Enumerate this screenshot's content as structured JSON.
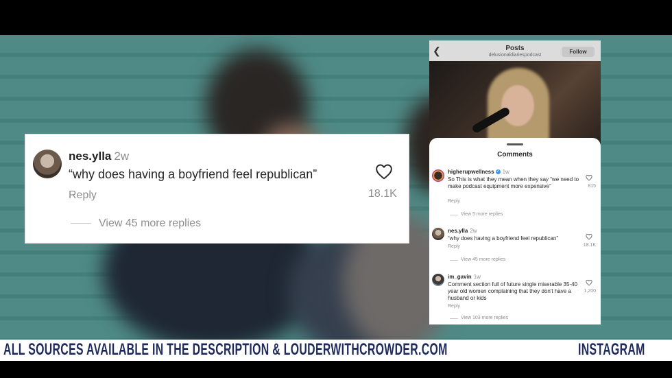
{
  "zoomed_comment": {
    "username": "nes.ylla",
    "time": "2w",
    "text": "“why does having a boyfriend feel republican”",
    "reply": "Reply",
    "likes": "18.1K",
    "view_more": "View 45 more replies"
  },
  "phone": {
    "header": {
      "title": "Posts",
      "subtitle": "delusionaldiariespodcast",
      "follow": "Follow",
      "back_icon": "chevron-left-icon"
    },
    "sheet_title": "Comments",
    "comments": [
      {
        "username": "higherupwellness",
        "verified": true,
        "time": "1w",
        "text": "So This is what they mean when they say “we need to make podcast equipment more expensive”",
        "reply": "Reply",
        "likes": "815",
        "view_more": "View 5 more replies"
      },
      {
        "username": "nes.ylla",
        "verified": false,
        "time": "2w",
        "text": "“why does having a boyfriend feel republican”",
        "reply": "Reply",
        "likes": "18.1K",
        "view_more": "View 45 more replies"
      },
      {
        "username": "im_gavin",
        "verified": false,
        "time": "1w",
        "text": "Comment section full of future single miserable 35-40 year old women complaining that they don't have a husband or kids",
        "reply": "Reply",
        "likes": "1,200",
        "view_more": "View 103 more replies"
      }
    ]
  },
  "ticker": {
    "main": "ALL SOURCES AVAILABLE IN THE DESCRIPTION & LOUDERWITHCROWDER.COM",
    "right": "INSTAGRAM"
  },
  "colors": {
    "ticker_text": "#1f2a5c",
    "verified": "#3897f0"
  }
}
